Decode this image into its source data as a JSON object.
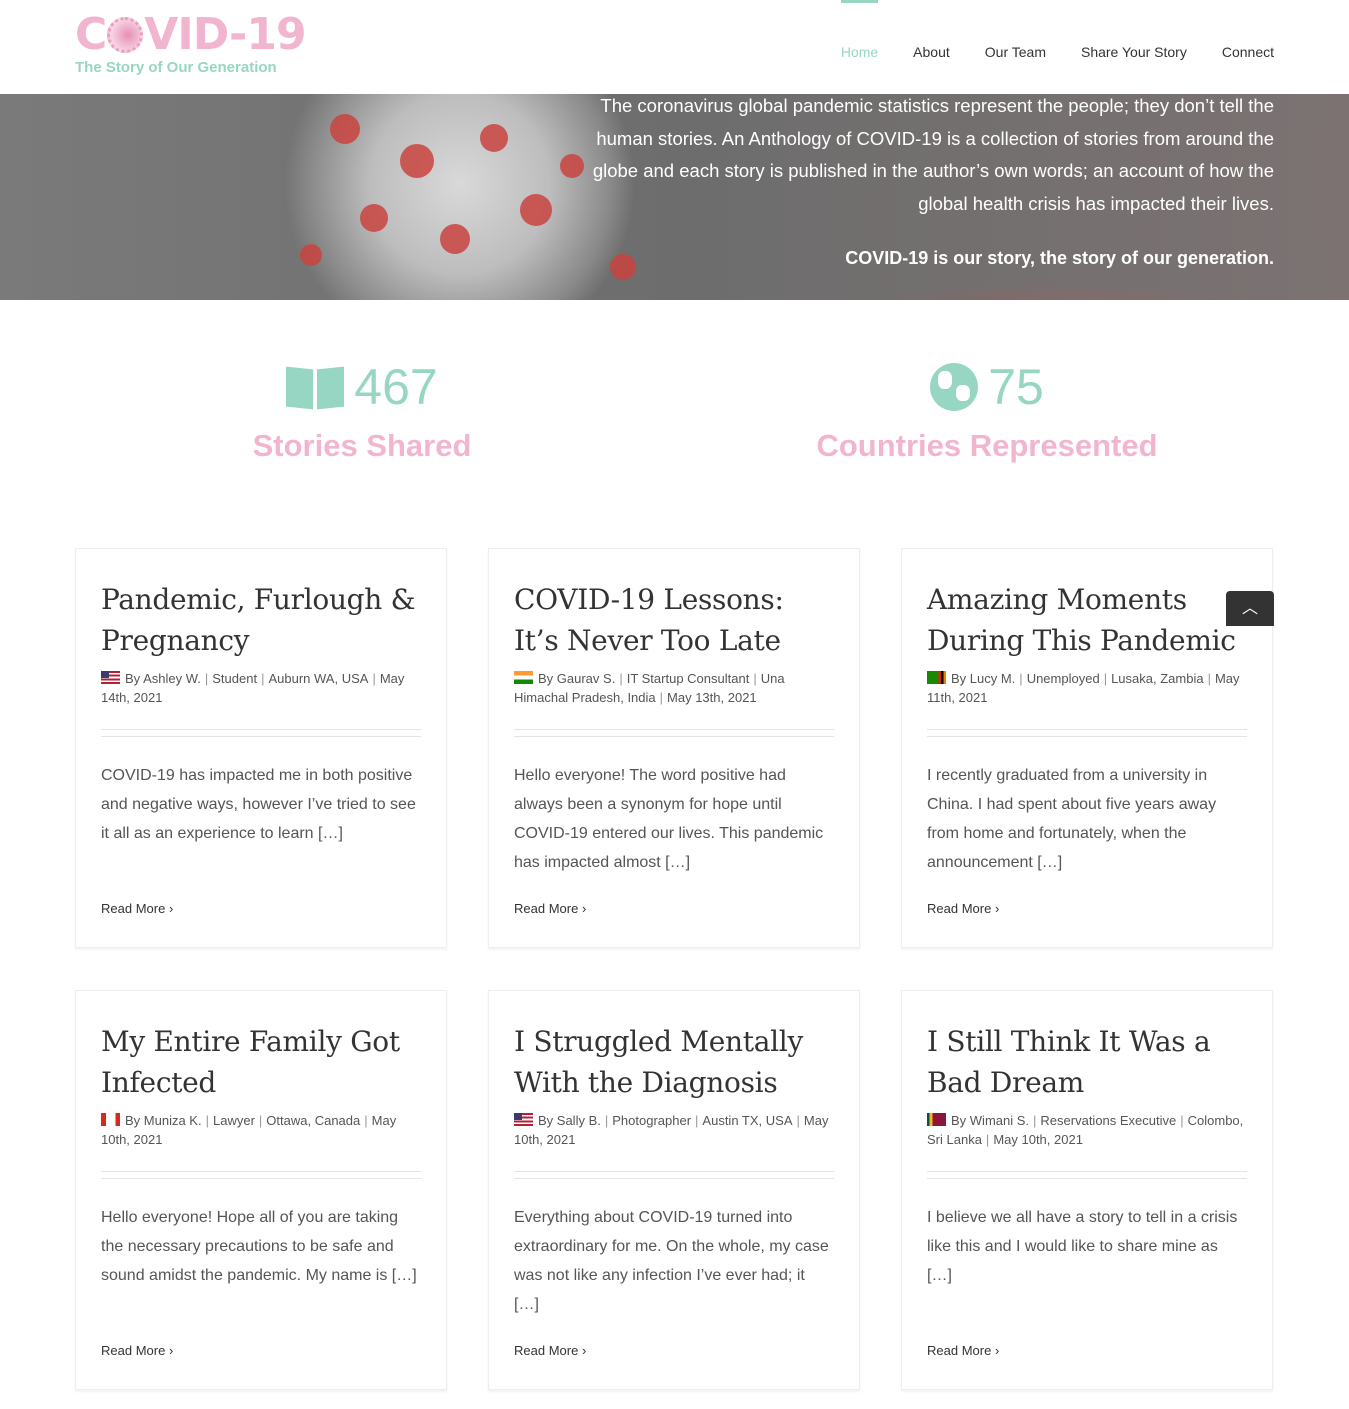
{
  "logo": {
    "title": "COVID-19",
    "tagline": "The Story of Our Generation"
  },
  "nav": [
    {
      "label": "Home"
    },
    {
      "label": "About"
    },
    {
      "label": "Our Team"
    },
    {
      "label": "Share Your Story"
    },
    {
      "label": "Connect"
    }
  ],
  "hero": {
    "text": "The coronavirus global pandemic statistics represent the people; they don’t tell the human stories. An Anthology of COVID-19 is a collection of stories from around the globe and each story is published in the author’s own words; an account of how the global health crisis has impacted their lives.",
    "tagline": "COVID-19 is our story, the story of our generation."
  },
  "stats": [
    {
      "icon": "book-icon",
      "value": "467",
      "label": "Stories Shared"
    },
    {
      "icon": "globe-icon",
      "value": "75",
      "label": "Countries Represented"
    }
  ],
  "colors": {
    "teal": "#96d6c3",
    "pink": "#f2b5d0"
  },
  "cards": [
    {
      "title": "Pandemic, Furlough & Pregnancy",
      "flag": "us",
      "author": "By Ashley W.",
      "occupation": "Student",
      "location": "Auburn WA, USA",
      "date": "May 14th, 2021",
      "excerpt": "COVID-19 has impacted me in both positive and negative ways, however I’ve tried to see it all as an experience to learn […]",
      "more": "Read More"
    },
    {
      "title": "COVID-19 Lessons: It’s Never Too Late",
      "flag": "in",
      "author": "By Gaurav S.",
      "occupation": "IT Startup Consultant",
      "location": "Una Himachal Pradesh, India",
      "date": "May 13th, 2021",
      "excerpt": "Hello everyone! The word positive had always been a synonym for hope until COVID-19 entered our lives. This pandemic has impacted almost […]",
      "more": "Read More"
    },
    {
      "title": "Amazing Moments During This Pandemic",
      "flag": "zm",
      "author": "By Lucy M.",
      "occupation": "Unemployed",
      "location": "Lusaka, Zambia",
      "date": "May 11th, 2021",
      "excerpt": "I recently graduated from a university in China. I had spent about five years away from home and fortunately, when the announcement […]",
      "more": "Read More"
    },
    {
      "title": "My Entire Family Got Infected",
      "flag": "ca",
      "author": "By Muniza K.",
      "occupation": "Lawyer",
      "location": "Ottawa, Canada",
      "date": "May 10th, 2021",
      "excerpt": "Hello everyone! Hope all of you are taking the necessary precautions to be safe and sound amidst the pandemic. My name is […]",
      "more": "Read More"
    },
    {
      "title": "I Struggled Mentally With the Diagnosis",
      "flag": "us",
      "author": "By Sally B.",
      "occupation": "Photographer",
      "location": "Austin TX, USA",
      "date": "May 10th, 2021",
      "excerpt": "Everything about COVID-19 turned into extraordinary for me. On the whole, my case was not like any infection I’ve ever had; it […]",
      "more": "Read More"
    },
    {
      "title": "I Still Think It Was a Bad Dream",
      "flag": "lk",
      "author": "By Wimani S.",
      "occupation": "Reservations Executive",
      "location": "Colombo, Sri Lanka",
      "date": "May 10th, 2021",
      "excerpt": "I believe we all have a story to tell in a crisis like this and I would like to share mine as […]",
      "more": "Read More"
    }
  ]
}
